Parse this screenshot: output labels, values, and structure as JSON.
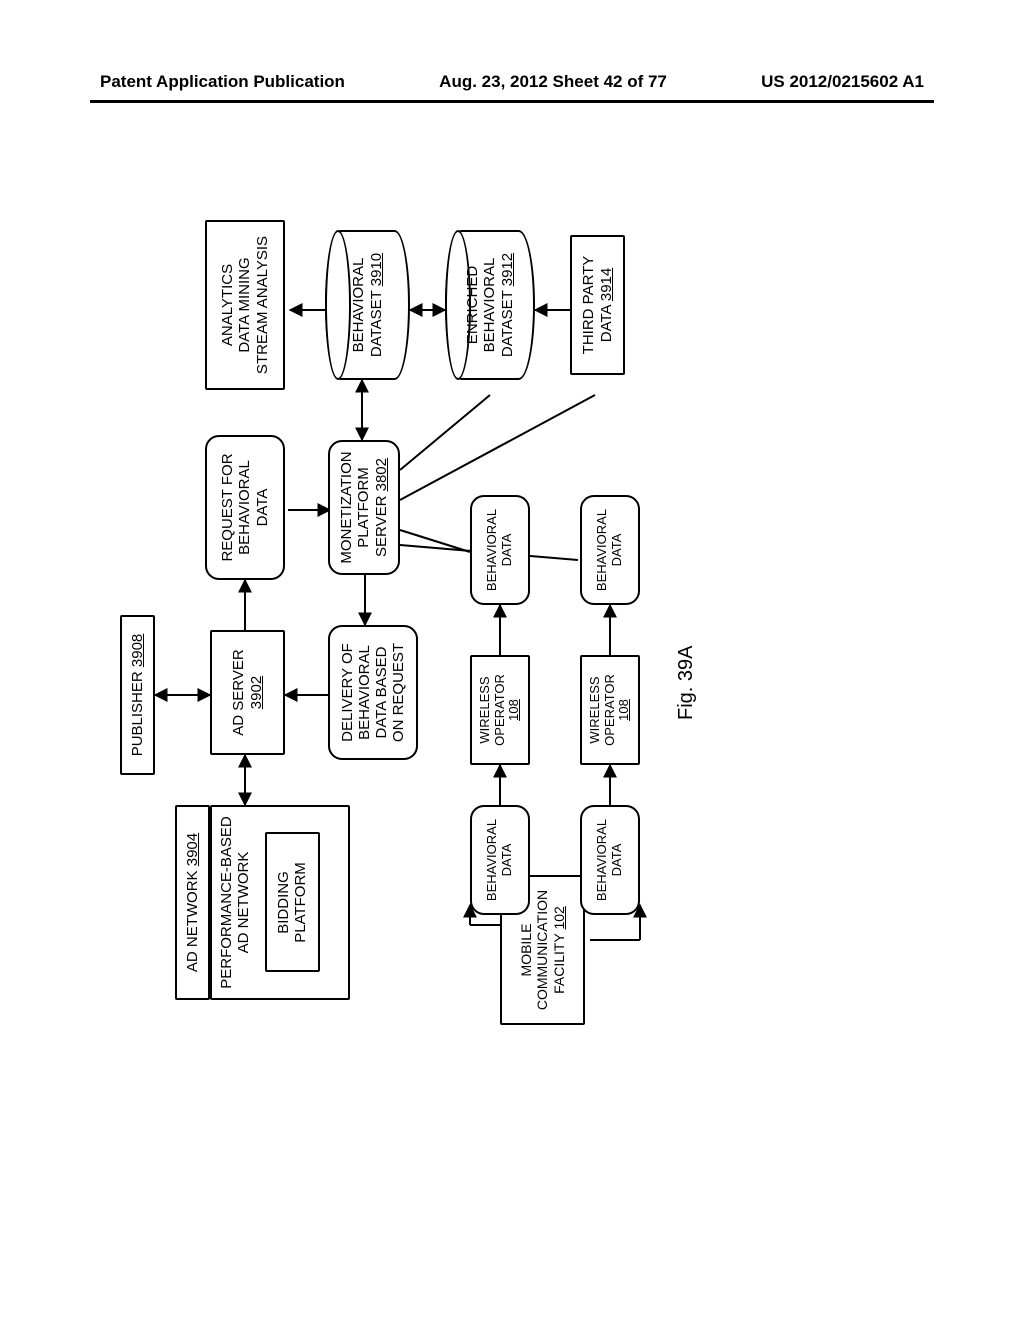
{
  "header": {
    "left": "Patent Application Publication",
    "center": "Aug. 23, 2012  Sheet 42 of 77",
    "right": "US 2012/0215602 A1"
  },
  "nodes": {
    "publisher": {
      "label": "PUBLISHER",
      "ref": "3908"
    },
    "ad_network": {
      "label": "AD NETWORK",
      "ref": "3904"
    },
    "perf_net": {
      "label": "PERFORMANCE-BASED\nAD NETWORK"
    },
    "bidding": {
      "label": "BIDDING\nPLATFORM"
    },
    "ad_server": {
      "label": "AD SERVER",
      "ref": "3902"
    },
    "request": {
      "label": "REQUEST FOR\nBEHAVIORAL\nDATA"
    },
    "analytics": {
      "label": "ANALYTICS\nDATA MINING\nSTREAM ANALYSIS"
    },
    "delivery": {
      "label": "DELIVERY OF\nBEHAVIORAL\nDATA BASED\nON REQUEST"
    },
    "monet": {
      "label": "MONETIZATION\nPLATFORM\nSERVER",
      "ref": "3802"
    },
    "bdataset": {
      "label": "BEHAVIORAL\nDATASET",
      "ref": "3910"
    },
    "ebdataset": {
      "label": "ENRICHED\nBEHAVIORAL\nDATASET",
      "ref": "3912"
    },
    "thirdparty": {
      "label": "THIRD PARTY\nDATA",
      "ref": "3914"
    },
    "mobile": {
      "label": "MOBILE\nCOMMUNICATION\nFACILITY",
      "ref": "102"
    },
    "bd1": {
      "label": "BEHAVIORAL\nDATA"
    },
    "bd2": {
      "label": "BEHAVIORAL\nDATA"
    },
    "bd3": {
      "label": "BEHAVIORAL\nDATA"
    },
    "bd4": {
      "label": "BEHAVIORAL\nDATA"
    },
    "wop1": {
      "label": "WIRELESS\nOPERATOR",
      "ref": "108"
    },
    "wop2": {
      "label": "WIRELESS\nOPERATOR",
      "ref": "108"
    }
  },
  "figure": "Fig. 39A"
}
